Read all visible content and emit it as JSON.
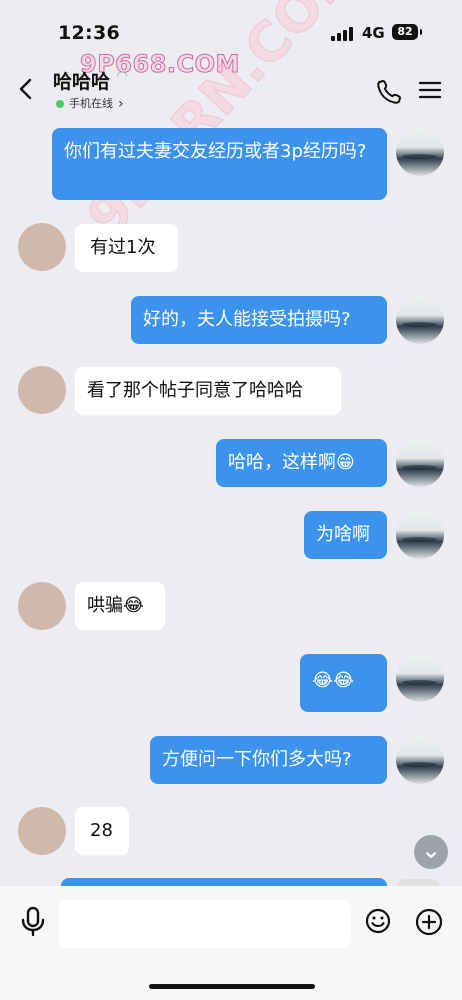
{
  "status": {
    "time": "12:36",
    "network": "4G",
    "battery": "82"
  },
  "header": {
    "name": "哈哈哈",
    "subtitle": "手机在线",
    "watermark": "9P668.COM",
    "diagonal_watermark": "9PORN.COM"
  },
  "messages": [
    {
      "side": "right",
      "text": "你们有过夫妻交友经历或者3p经历吗?"
    },
    {
      "side": "left",
      "text": "有过1次"
    },
    {
      "side": "right",
      "text": "好的，夫人能接受拍摄吗?"
    },
    {
      "side": "left",
      "text": "看了那个帖子同意了哈哈哈"
    },
    {
      "side": "right",
      "text": "哈哈，这样啊😁"
    },
    {
      "side": "right",
      "text": "为啥啊"
    },
    {
      "side": "left",
      "text": "哄骗😂"
    },
    {
      "side": "right",
      "text": "😂😂"
    },
    {
      "side": "right",
      "text": "方便问一下你们多大吗?"
    },
    {
      "side": "left",
      "text": "28"
    }
  ],
  "input": {
    "value": "",
    "placeholder": ""
  },
  "icons": {
    "back": "chevron-left-icon",
    "call": "phone-icon",
    "menu": "menu-icon",
    "voice": "microphone-icon",
    "emoji": "smile-icon",
    "add": "plus-icon",
    "scroll": "chevron-down-icon"
  },
  "colors": {
    "outgoing_bubble": "#3b93ed",
    "incoming_bubble": "#ffffff",
    "background": "#ececf1",
    "online": "#4ccd63"
  }
}
